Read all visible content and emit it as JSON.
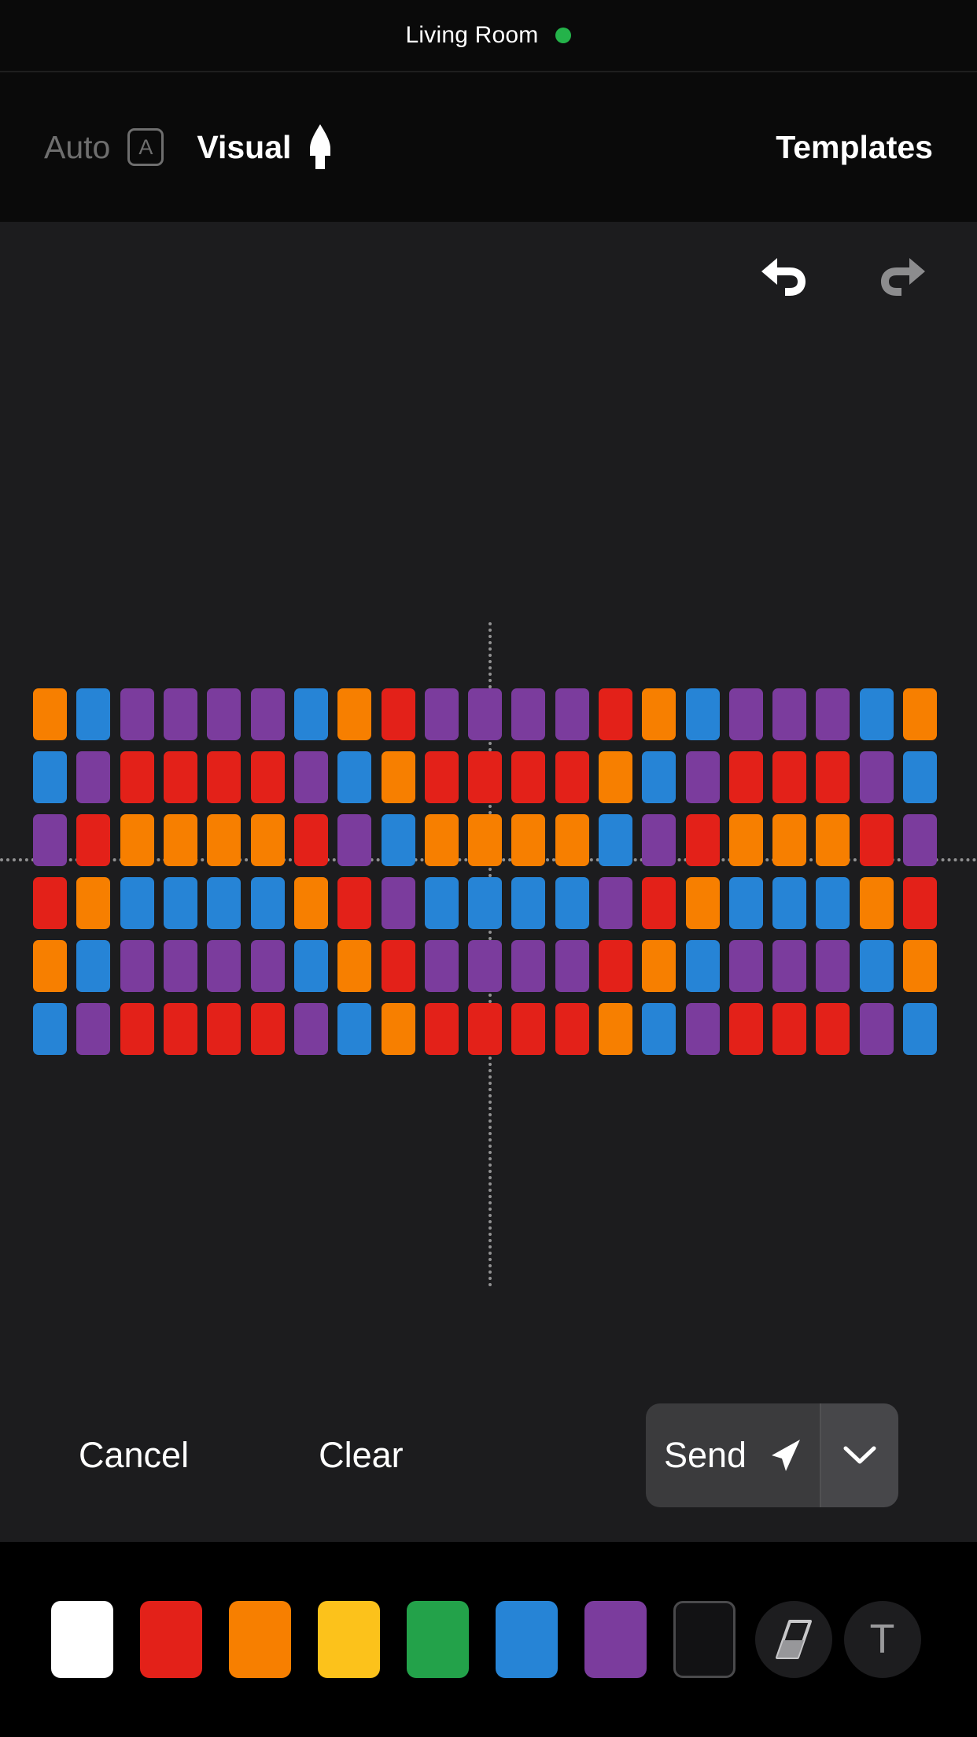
{
  "statusbar": {
    "title": "Living Room",
    "status_dot_color": "#24b34a",
    "status_indicator_name": "online"
  },
  "navbar": {
    "auto_label": "Auto",
    "auto_badge": "A",
    "auto_active": false,
    "visual_label": "Visual",
    "visual_icon": "pen-nib-icon",
    "visual_active": true,
    "templates_label": "Templates"
  },
  "canvas": {
    "undo_icon": "undo-arrow-icon",
    "undo_enabled": true,
    "undo_color": "#ffffff",
    "redo_icon": "redo-arrow-icon",
    "redo_enabled": false,
    "redo_color": "#8c8c8e",
    "guide_vertical": true,
    "guide_horizontal": true,
    "guide_color": "#b9b9b9",
    "background": "#1c1c1e"
  },
  "grid": {
    "columns": 21,
    "rows": 6,
    "palette_map": {
      "o": "#f77f00",
      "b": "#2684d6",
      "p": "#7b3c9d",
      "r": "#e32119"
    },
    "cells": [
      [
        "o",
        "b",
        "p",
        "p",
        "p",
        "p",
        "b",
        "o",
        "r",
        "p",
        "p",
        "p",
        "p",
        "r",
        "o",
        "b",
        "p",
        "p",
        "p",
        "b",
        "o"
      ],
      [
        "b",
        "p",
        "r",
        "r",
        "r",
        "r",
        "p",
        "b",
        "o",
        "r",
        "r",
        "r",
        "r",
        "o",
        "b",
        "p",
        "r",
        "r",
        "r",
        "p",
        "b"
      ],
      [
        "p",
        "r",
        "o",
        "o",
        "o",
        "o",
        "r",
        "p",
        "b",
        "o",
        "o",
        "o",
        "o",
        "b",
        "p",
        "r",
        "o",
        "o",
        "o",
        "r",
        "p"
      ],
      [
        "r",
        "o",
        "b",
        "b",
        "b",
        "b",
        "o",
        "r",
        "p",
        "b",
        "b",
        "b",
        "b",
        "p",
        "r",
        "o",
        "b",
        "b",
        "b",
        "o",
        "r"
      ],
      [
        "o",
        "b",
        "p",
        "p",
        "p",
        "p",
        "b",
        "o",
        "r",
        "p",
        "p",
        "p",
        "p",
        "r",
        "o",
        "b",
        "p",
        "p",
        "p",
        "b",
        "o"
      ],
      [
        "b",
        "p",
        "r",
        "r",
        "r",
        "r",
        "p",
        "b",
        "o",
        "r",
        "r",
        "r",
        "r",
        "o",
        "b",
        "p",
        "r",
        "r",
        "r",
        "p",
        "b"
      ]
    ]
  },
  "actions": {
    "cancel_label": "Cancel",
    "clear_label": "Clear",
    "send_label": "Send",
    "send_icon": "paper-plane-icon",
    "send_caret_icon": "chevron-down-icon"
  },
  "palette_bar": {
    "swatches": [
      {
        "name": "white",
        "color": "#ffffff",
        "selected": false
      },
      {
        "name": "red",
        "color": "#e32119",
        "selected": false
      },
      {
        "name": "orange",
        "color": "#f77f00",
        "selected": false
      },
      {
        "name": "yellow",
        "color": "#fcc21b",
        "selected": false
      },
      {
        "name": "green",
        "color": "#23a24a",
        "selected": false
      },
      {
        "name": "blue",
        "color": "#2684d6",
        "selected": false
      },
      {
        "name": "purple",
        "color": "#7b3c9d",
        "selected": false
      },
      {
        "name": "black",
        "color": "#121214",
        "selected": false,
        "outlined": true
      }
    ],
    "tools": [
      {
        "name": "eraser-icon",
        "label": ""
      },
      {
        "name": "text-tool-icon",
        "label": "T"
      }
    ]
  }
}
